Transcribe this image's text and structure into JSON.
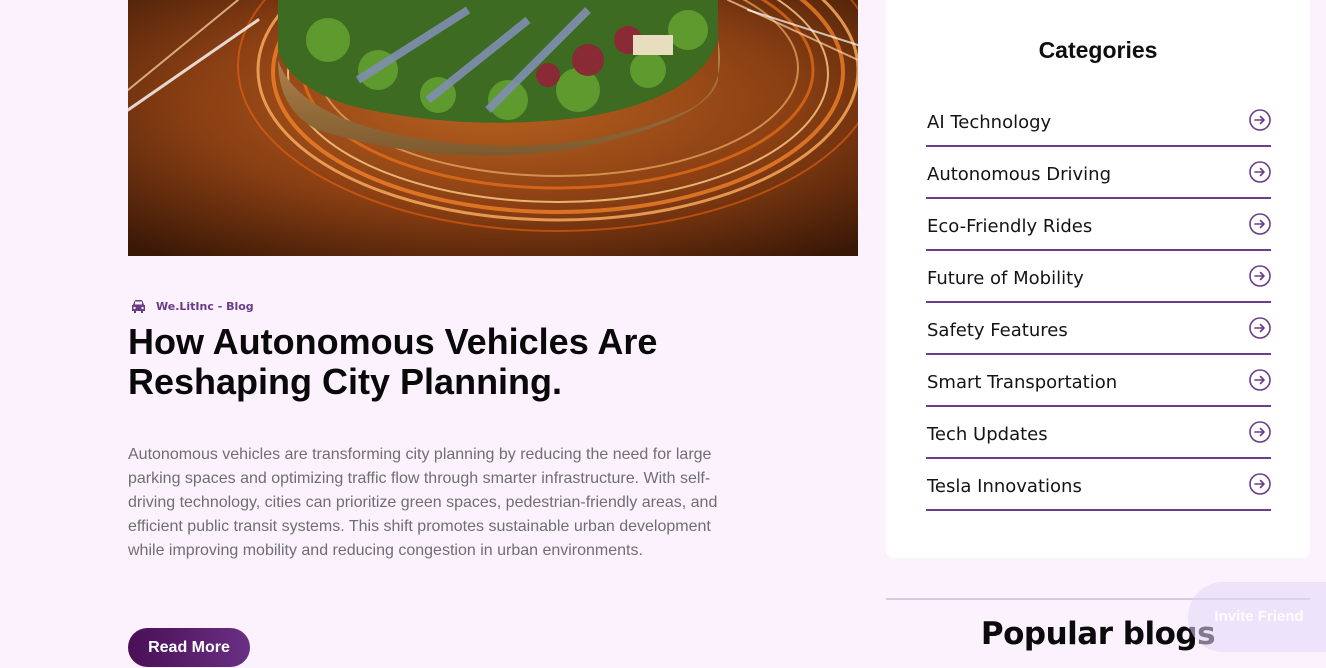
{
  "post": {
    "meta_label": "We.LitInc - Blog",
    "title": "How Autonomous Vehicles Are Reshaping City Planning.",
    "excerpt": "Autonomous vehicles are transforming city planning by reducing the need for large parking spaces and optimizing traffic flow through smarter infrastructure. With self-driving technology, cities can prioritize green spaces, pedestrian-friendly areas, and efficient public transit systems. This shift promotes sustainable urban development while improving mobility and reducing congestion in urban environments.",
    "read_more_label": "Read More",
    "image_icon": "roundabout-traffic-photo",
    "meta_icon": "car-icon"
  },
  "categories": {
    "heading": "Categories",
    "items": [
      {
        "label": "AI Technology",
        "icon": "arrow-right-circle-icon"
      },
      {
        "label": "Autonomous Driving",
        "icon": "arrow-right-circle-icon"
      },
      {
        "label": "Eco-Friendly Rides",
        "icon": "arrow-right-circle-icon"
      },
      {
        "label": "Future of Mobility",
        "icon": "arrow-right-circle-icon"
      },
      {
        "label": "Safety Features",
        "icon": "arrow-right-circle-icon"
      },
      {
        "label": "Smart Transportation",
        "icon": "arrow-right-circle-icon"
      },
      {
        "label": "Tech Updates",
        "icon": "arrow-right-circle-icon"
      },
      {
        "label": "Tesla Innovations",
        "icon": "arrow-right-circle-icon"
      }
    ]
  },
  "popular": {
    "heading": "Popular blogs"
  },
  "invite": {
    "label": "Invite Friend"
  },
  "colors": {
    "page_background": "#fbf2fe",
    "accent_purple": "#6b3d8a",
    "button_gradient_start": "#4a0f57",
    "button_gradient_end": "#6a2f82"
  }
}
